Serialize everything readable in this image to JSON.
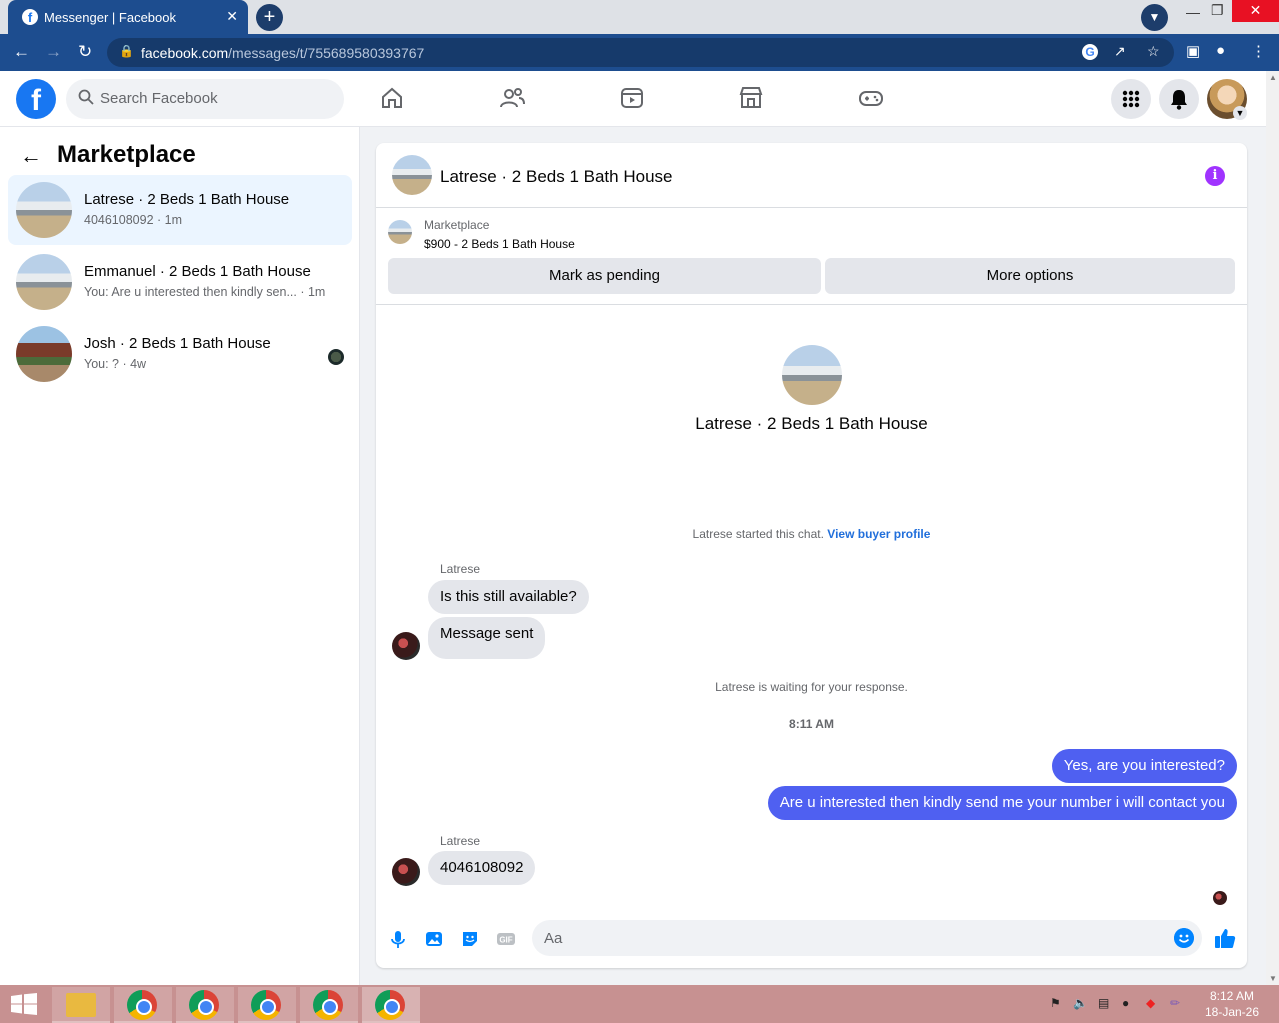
{
  "browser": {
    "tab_title": "Messenger | Facebook",
    "tab_close": "✕",
    "new_tab": "+",
    "url_host": "facebook.com",
    "url_path": "/messages/t/755689580393767"
  },
  "facebook": {
    "logo": "f",
    "search_placeholder": "Search Facebook"
  },
  "left_panel": {
    "title": "Marketplace",
    "conversations": [
      {
        "name": "Latrese · 2 Beds 1 Bath House",
        "subtitle": "4046108092 · 1m",
        "active": true
      },
      {
        "name": "Emmanuel · 2 Beds 1 Bath House",
        "subtitle": "You: Are u interested then kindly sen... · 1m",
        "active": false
      },
      {
        "name": "Josh · 2 Beds 1 Bath House",
        "subtitle": "You: ? · 4w",
        "active": false
      }
    ]
  },
  "chat": {
    "title": "Latrese · 2 Beds 1 Bath House",
    "listing": {
      "source": "Marketplace",
      "price_title": "$900 - 2 Beds 1 Bath House",
      "mark_pending_label": "Mark as pending",
      "more_options_label": "More options"
    },
    "center_name": "Latrese · 2 Beds 1 Bath House",
    "started_text": "Latrese started this chat.",
    "view_profile_link": "View buyer profile",
    "sender_name_1": "Latrese",
    "in_msg_1": "Is this still available?",
    "in_msg_2": "Message sent",
    "waiting_text": "Latrese is waiting for your response.",
    "time_label": "8:11 AM",
    "out_msg_1": "Yes, are you interested?",
    "out_msg_2": "Are u interested then kindly send me your number i will contact you",
    "sender_name_2": "Latrese",
    "in_msg_3": "4046108092",
    "composer_placeholder": "Aa"
  },
  "taskbar": {
    "time": "8:12 AM",
    "date": "18-Jan-26"
  },
  "colors": {
    "fb_blue": "#1877f2",
    "outgoing_bubble": "#4f60f1",
    "incoming_bubble": "#e4e6eb",
    "chrome_frame": "#1d4d8f",
    "taskbar": "#c79191"
  }
}
